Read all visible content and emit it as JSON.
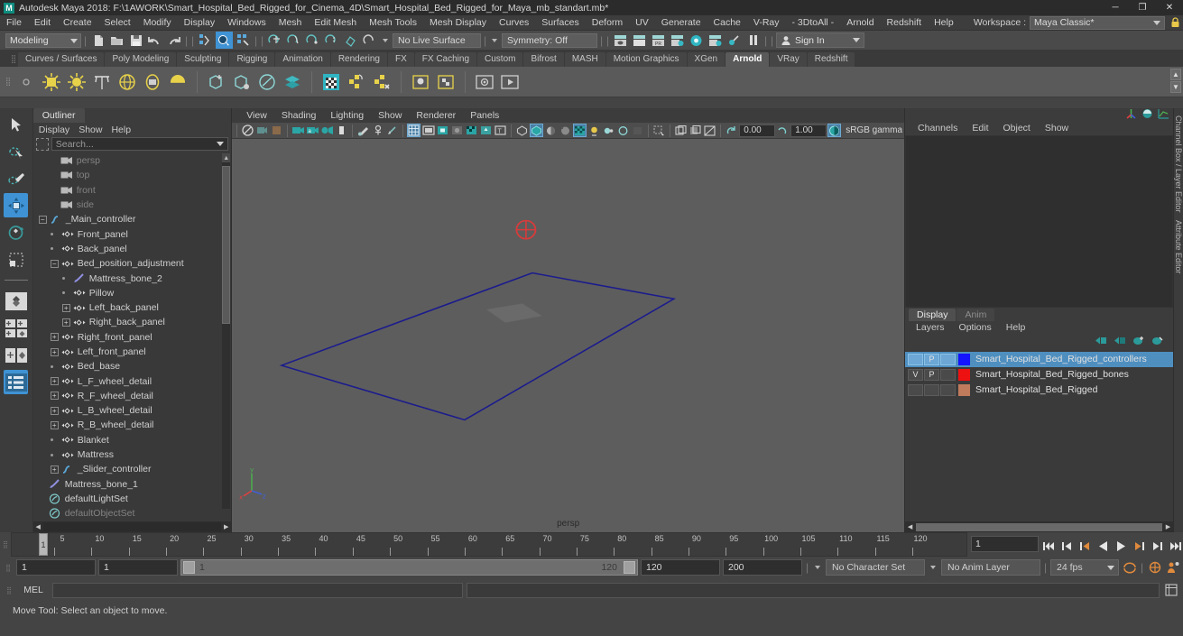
{
  "window": {
    "title": "Autodesk Maya 2018: F:\\1AWORK\\Smart_Hospital_Bed_Rigged_for_Cinema_4D\\Smart_Hospital_Bed_Rigged_for_Maya_mb_standart.mb*",
    "logo": "M",
    "minimize": "─",
    "maximize": "❐",
    "close": "✕"
  },
  "menubar": {
    "items": [
      "File",
      "Edit",
      "Create",
      "Select",
      "Modify",
      "Display",
      "Windows",
      "Mesh",
      "Edit Mesh",
      "Mesh Tools",
      "Mesh Display",
      "Curves",
      "Surfaces",
      "Deform",
      "UV",
      "Generate",
      "Cache",
      "V-Ray",
      "- 3DtoAll -",
      "Arnold",
      "Redshift",
      "Help"
    ],
    "workspace_label": "Workspace :",
    "workspace_value": "Maya Classic*"
  },
  "statusbar": {
    "mode": "Modeling",
    "live_surface": "No Live Surface",
    "symmetry": "Symmetry: Off",
    "signin": "Sign In"
  },
  "shelf": {
    "tabs": [
      "Curves / Surfaces",
      "Poly Modeling",
      "Sculpting",
      "Rigging",
      "Animation",
      "Rendering",
      "FX",
      "FX Caching",
      "Custom",
      "Bifrost",
      "MASH",
      "Motion Graphics",
      "XGen",
      "Arnold",
      "VRay",
      "Redshift"
    ],
    "selected_tab": "Arnold"
  },
  "outliner": {
    "tab": "Outliner",
    "menu": [
      "Display",
      "Show",
      "Help"
    ],
    "search_placeholder": "Search...",
    "items": [
      {
        "label": "persp",
        "indent": 1,
        "icon": "camera",
        "dim": true,
        "handle": "none"
      },
      {
        "label": "top",
        "indent": 1,
        "icon": "camera",
        "dim": true,
        "handle": "none"
      },
      {
        "label": "front",
        "indent": 1,
        "icon": "camera",
        "dim": true,
        "handle": "none"
      },
      {
        "label": "side",
        "indent": 1,
        "icon": "camera",
        "dim": true,
        "handle": "none"
      },
      {
        "label": "_Main_controller",
        "indent": 0,
        "icon": "curve",
        "dim": false,
        "handle": "minus"
      },
      {
        "label": "Front_panel",
        "indent": 1,
        "icon": "transform",
        "dim": false,
        "handle": "dot"
      },
      {
        "label": "Back_panel",
        "indent": 1,
        "icon": "transform",
        "dim": false,
        "handle": "dot"
      },
      {
        "label": "Bed_position_adjustment",
        "indent": 1,
        "icon": "transform",
        "dim": false,
        "handle": "minus"
      },
      {
        "label": "Mattress_bone_2",
        "indent": 2,
        "icon": "joint",
        "dim": false,
        "handle": "dot"
      },
      {
        "label": "Pillow",
        "indent": 2,
        "icon": "transform",
        "dim": false,
        "handle": "dot"
      },
      {
        "label": "Left_back_panel",
        "indent": 2,
        "icon": "transform",
        "dim": false,
        "handle": "plus"
      },
      {
        "label": "Right_back_panel",
        "indent": 2,
        "icon": "transform",
        "dim": false,
        "handle": "plus"
      },
      {
        "label": "Right_front_panel",
        "indent": 1,
        "icon": "transform",
        "dim": false,
        "handle": "plus"
      },
      {
        "label": "Left_front_panel",
        "indent": 1,
        "icon": "transform",
        "dim": false,
        "handle": "plus"
      },
      {
        "label": "Bed_base",
        "indent": 1,
        "icon": "transform",
        "dim": false,
        "handle": "dot"
      },
      {
        "label": "L_F_wheel_detail",
        "indent": 1,
        "icon": "transform",
        "dim": false,
        "handle": "plus"
      },
      {
        "label": "R_F_wheel_detail",
        "indent": 1,
        "icon": "transform",
        "dim": false,
        "handle": "plus"
      },
      {
        "label": "L_B_wheel_detail",
        "indent": 1,
        "icon": "transform",
        "dim": false,
        "handle": "plus"
      },
      {
        "label": "R_B_wheel_detail",
        "indent": 1,
        "icon": "transform",
        "dim": false,
        "handle": "plus"
      },
      {
        "label": "Blanket",
        "indent": 1,
        "icon": "transform",
        "dim": false,
        "handle": "dot"
      },
      {
        "label": "Mattress",
        "indent": 1,
        "icon": "transform",
        "dim": false,
        "handle": "dot"
      },
      {
        "label": "_Slider_controller",
        "indent": 1,
        "icon": "curve",
        "dim": false,
        "handle": "plus"
      },
      {
        "label": "Mattress_bone_1",
        "indent": 0,
        "icon": "joint",
        "dim": false,
        "handle": "none"
      },
      {
        "label": "defaultLightSet",
        "indent": 0,
        "icon": "set",
        "dim": false,
        "handle": "none"
      },
      {
        "label": "defaultObjectSet",
        "indent": 0,
        "icon": "set",
        "dim": true,
        "handle": "none"
      }
    ]
  },
  "viewport": {
    "menu": [
      "View",
      "Shading",
      "Lighting",
      "Show",
      "Renderer",
      "Panels"
    ],
    "exposure": "0.00",
    "gamma": "1.00",
    "colorspace": "sRGB gamma",
    "camera_label": "persp"
  },
  "channelbox": {
    "menu": [
      "Channels",
      "Edit",
      "Object",
      "Show"
    ]
  },
  "layers": {
    "tabs": [
      "Display",
      "Anim"
    ],
    "selected_tab": "Display",
    "menu": [
      "Layers",
      "Options",
      "Help"
    ],
    "rows": [
      {
        "v": "",
        "p": "P",
        "third": "",
        "color": "#1414ff",
        "name": "Smart_Hospital_Bed_Rigged_controllers",
        "selected": true
      },
      {
        "v": "V",
        "p": "P",
        "third": "",
        "color": "#ee1111",
        "name": "Smart_Hospital_Bed_Rigged_bones",
        "selected": false
      },
      {
        "v": "",
        "p": "",
        "third": "",
        "color": "#c07a5c",
        "name": "Smart_Hospital_Bed_Rigged",
        "selected": false
      }
    ]
  },
  "rightstrip": {
    "labels": [
      "Channel Box / Layer Editor",
      "Attribute Editor"
    ]
  },
  "timeline": {
    "ticks": [
      5,
      10,
      15,
      20,
      25,
      30,
      35,
      40,
      45,
      50,
      55,
      60,
      65,
      70,
      75,
      80,
      85,
      90,
      95,
      100,
      105,
      110,
      115,
      120
    ],
    "start": 1,
    "end": 120,
    "current_frame": "1",
    "playhead_label": "1"
  },
  "rangebar": {
    "anim_start": "1",
    "range_start": "1",
    "slider_min": "1",
    "slider_max": "120",
    "range_end": "120",
    "anim_end": "200",
    "character_set": "No Character Set",
    "anim_layer": "No Anim Layer",
    "fps": "24 fps"
  },
  "command": {
    "label": "MEL",
    "input_value": "",
    "help_text": "Move Tool: Select an object to move."
  }
}
